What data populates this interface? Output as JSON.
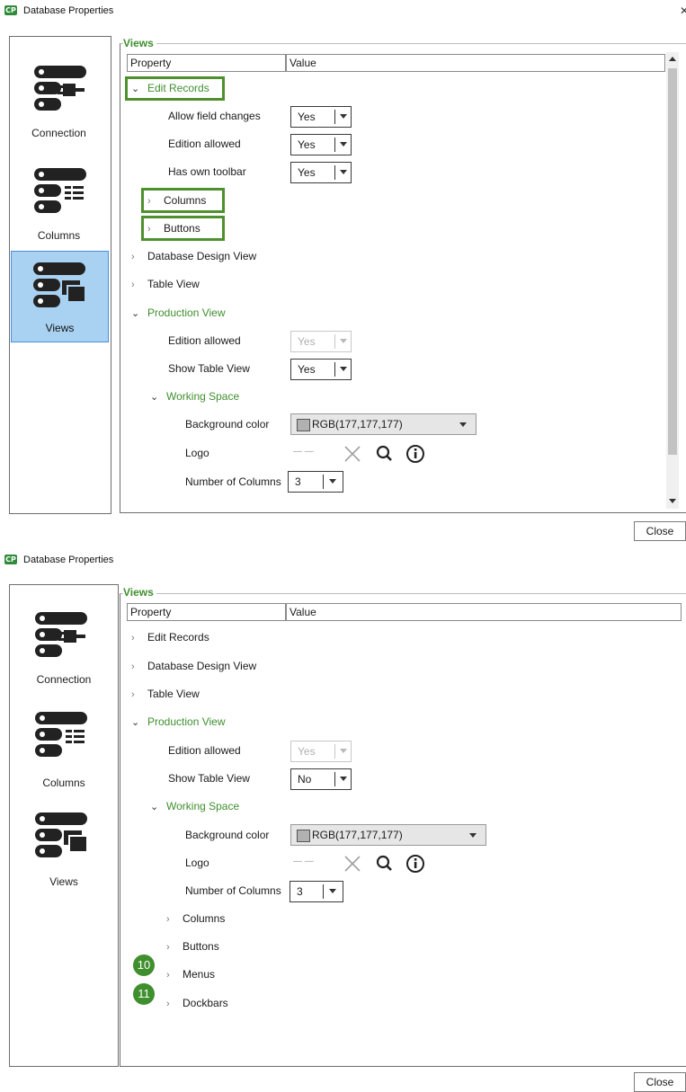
{
  "window": {
    "title": "Database Properties",
    "close_glyph": "✕"
  },
  "nav": {
    "connection": "Connection",
    "columns": "Columns",
    "views": "Views"
  },
  "group_title": "Views",
  "headers": {
    "property": "Property",
    "value": "Value"
  },
  "panel1": {
    "rows": {
      "edit_records": "Edit Records",
      "allow_field_changes": "Allow field changes",
      "edition_allowed_a": "Edition allowed",
      "has_own_toolbar": "Has own toolbar",
      "columns": "Columns",
      "buttons": "Buttons",
      "db_design_view": "Database Design View",
      "table_view": "Table View",
      "production_view": "Production View",
      "edition_allowed_b": "Edition allowed",
      "show_table_view": "Show Table View",
      "working_space": "Working Space",
      "background_color": "Background color",
      "logo": "Logo",
      "number_of_columns": "Number of Columns"
    },
    "values": {
      "allow_field_changes": "Yes",
      "edition_allowed_a": "Yes",
      "has_own_toolbar": "Yes",
      "edition_allowed_b": "Yes",
      "show_table_view": "Yes",
      "background_color": "RGB(177,177,177)",
      "logo_placeholder": "— —",
      "number_of_columns": "3"
    }
  },
  "panel2": {
    "rows": {
      "edit_records": "Edit Records",
      "db_design_view": "Database Design View",
      "table_view": "Table View",
      "production_view": "Production View",
      "edition_allowed": "Edition allowed",
      "show_table_view": "Show Table View",
      "working_space": "Working Space",
      "background_color": "Background color",
      "logo": "Logo",
      "number_of_columns": "Number of Columns",
      "columns": "Columns",
      "buttons": "Buttons",
      "menus": "Menus",
      "dockbars": "Dockbars"
    },
    "values": {
      "edition_allowed": "Yes",
      "show_table_view": "No",
      "background_color": "RGB(177,177,177)",
      "logo_placeholder": "— —",
      "number_of_columns": "3"
    },
    "badges": {
      "menus": "10",
      "dockbars": "11"
    }
  },
  "close_label": "Close",
  "glyphs": {
    "chev_right": "›",
    "chev_down": "⌄"
  },
  "colors": {
    "accent_green": "#3f8f2e",
    "selected_nav": "#a9d1f1",
    "swatch": "#b1b1b1"
  },
  "icons": [
    "app-icon",
    "connection-icon",
    "columns-icon",
    "views-icon",
    "clear-x-icon",
    "search-icon",
    "info-icon"
  ]
}
